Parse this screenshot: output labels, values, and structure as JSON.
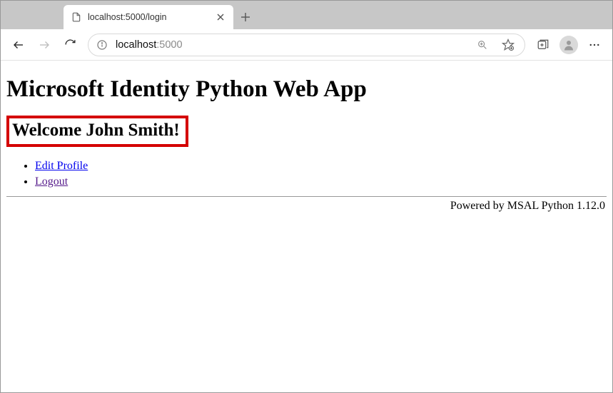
{
  "browser": {
    "tab_title": "localhost:5000/login",
    "url_host": "localhost",
    "url_rest": ":5000"
  },
  "page": {
    "heading": "Microsoft Identity Python Web App",
    "welcome": "Welcome John Smith!",
    "links": {
      "edit_profile": "Edit Profile",
      "logout": "Logout"
    },
    "footer": "Powered by MSAL Python 1.12.0"
  }
}
